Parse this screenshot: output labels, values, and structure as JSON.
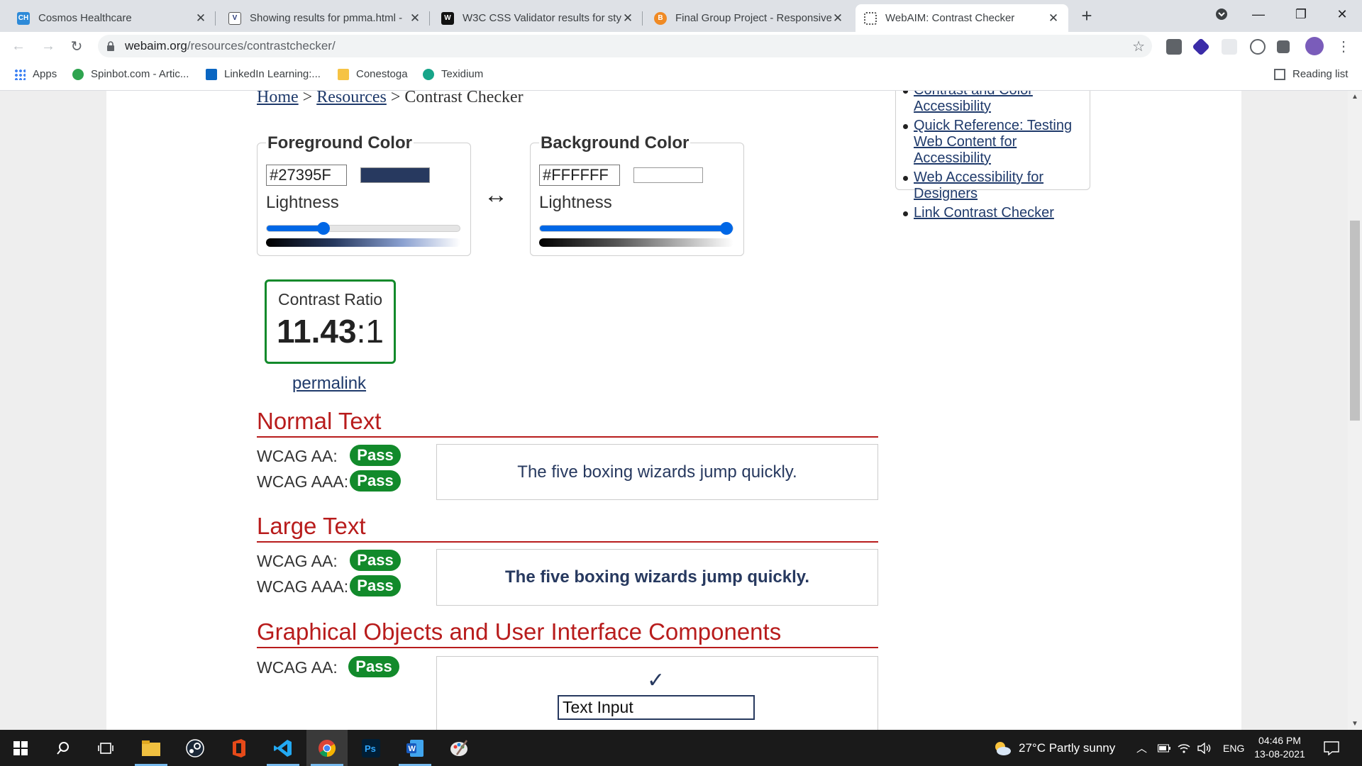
{
  "browser": {
    "tabs": [
      {
        "favicon": "cosmos-favicon",
        "title": "Cosmos Healthcare",
        "active": false
      },
      {
        "favicon": "validator-favicon",
        "title": "Showing results for pmma.html -",
        "active": false
      },
      {
        "favicon": "w3c-favicon",
        "title": "W3C CSS Validator results for sty",
        "active": false
      },
      {
        "favicon": "project-favicon",
        "title": "Final Group Project - Responsive",
        "active": false
      },
      {
        "favicon": "webaim-favicon",
        "title": "WebAIM: Contrast Checker",
        "active": true
      }
    ],
    "url_host": "webaim.org",
    "url_path": "/resources/contrastchecker/",
    "bookmarks": [
      {
        "label": "Apps",
        "icon": "apps-grid-icon"
      },
      {
        "label": "Spinbot.com - Artic...",
        "icon": "spinbot-icon"
      },
      {
        "label": "LinkedIn Learning:...",
        "icon": "linkedin-learning-icon"
      },
      {
        "label": "Conestoga",
        "icon": "folder-icon"
      },
      {
        "label": "Texidium",
        "icon": "texidium-icon"
      }
    ],
    "reading_list": "Reading list"
  },
  "breadcrumb": {
    "home": "Home",
    "sep1": ">",
    "resources": "Resources",
    "sep2": ">",
    "current": "Contrast Checker"
  },
  "foreground": {
    "legend": "Foreground Color",
    "hex": "#27395F",
    "lightness_label": "Lightness",
    "lightness_value": 0.28,
    "color": "#27395f"
  },
  "background": {
    "legend": "Background Color",
    "hex": "#FFFFFF",
    "lightness_label": "Lightness",
    "lightness_value": 1.0,
    "color": "#ffffff"
  },
  "swap_symbol": "↔",
  "contrast": {
    "label": "Contrast Ratio",
    "ratio_bold": "11.43",
    "ratio_rest": ":1",
    "permalink": "permalink"
  },
  "normal_text": {
    "heading": "Normal Text",
    "aa_label": "WCAG AA:",
    "aa_result": "Pass",
    "aaa_label": "WCAG AAA:",
    "aaa_result": "Pass",
    "sample": "The five boxing wizards jump quickly."
  },
  "large_text": {
    "heading": "Large Text",
    "aa_label": "WCAG AA:",
    "aa_result": "Pass",
    "aaa_label": "WCAG AAA:",
    "aaa_result": "Pass",
    "sample": "The five boxing wizards jump quickly."
  },
  "graphical": {
    "heading": "Graphical Objects and User Interface Components",
    "aa_label": "WCAG AA:",
    "aa_result": "Pass",
    "check": "✓",
    "text_input": "Text Input"
  },
  "sidebar": {
    "links": [
      "Contrast and Color Accessibility",
      "Quick Reference: Testing Web Content for Accessibility",
      "Web Accessibility for Designers",
      "Link Contrast Checker"
    ]
  },
  "taskbar": {
    "weather": "27°C  Partly sunny",
    "language": "ENG",
    "time": "04:46 PM",
    "date": "13-08-2021"
  },
  "colors": {
    "pass_green": "#128a2b",
    "heading_red": "#b81c1c",
    "link_blue": "#1f3a6b"
  }
}
